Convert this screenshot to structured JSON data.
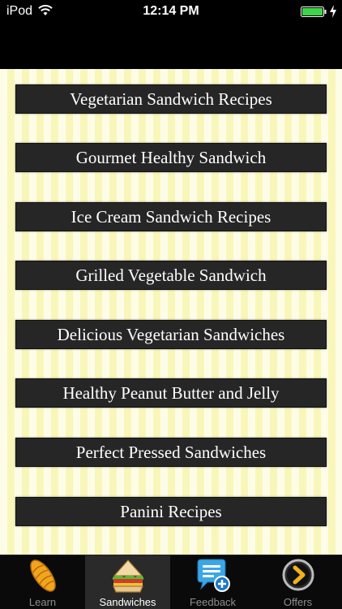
{
  "status_bar": {
    "carrier": "iPod",
    "time": "12:14 PM",
    "battery_color": "#3fd34a"
  },
  "menu": {
    "items": [
      {
        "label": "Vegetarian Sandwich Recipes"
      },
      {
        "label": "Gourmet Healthy Sandwich"
      },
      {
        "label": "Ice Cream Sandwich Recipes"
      },
      {
        "label": "Grilled Vegetable Sandwich"
      },
      {
        "label": "Delicious Vegetarian Sandwiches"
      },
      {
        "label": "Healthy Peanut Butter and Jelly"
      },
      {
        "label": "Perfect Pressed Sandwiches"
      },
      {
        "label": "Panini Recipes"
      }
    ]
  },
  "tab_bar": {
    "tabs": [
      {
        "label": "Learn",
        "icon": "bread-icon"
      },
      {
        "label": "Sandwiches",
        "icon": "sandwich-icon",
        "selected": true
      },
      {
        "label": "Feedback",
        "icon": "feedback-bubble-icon"
      },
      {
        "label": "Offers",
        "icon": "chevron-right-circle-icon"
      }
    ]
  }
}
